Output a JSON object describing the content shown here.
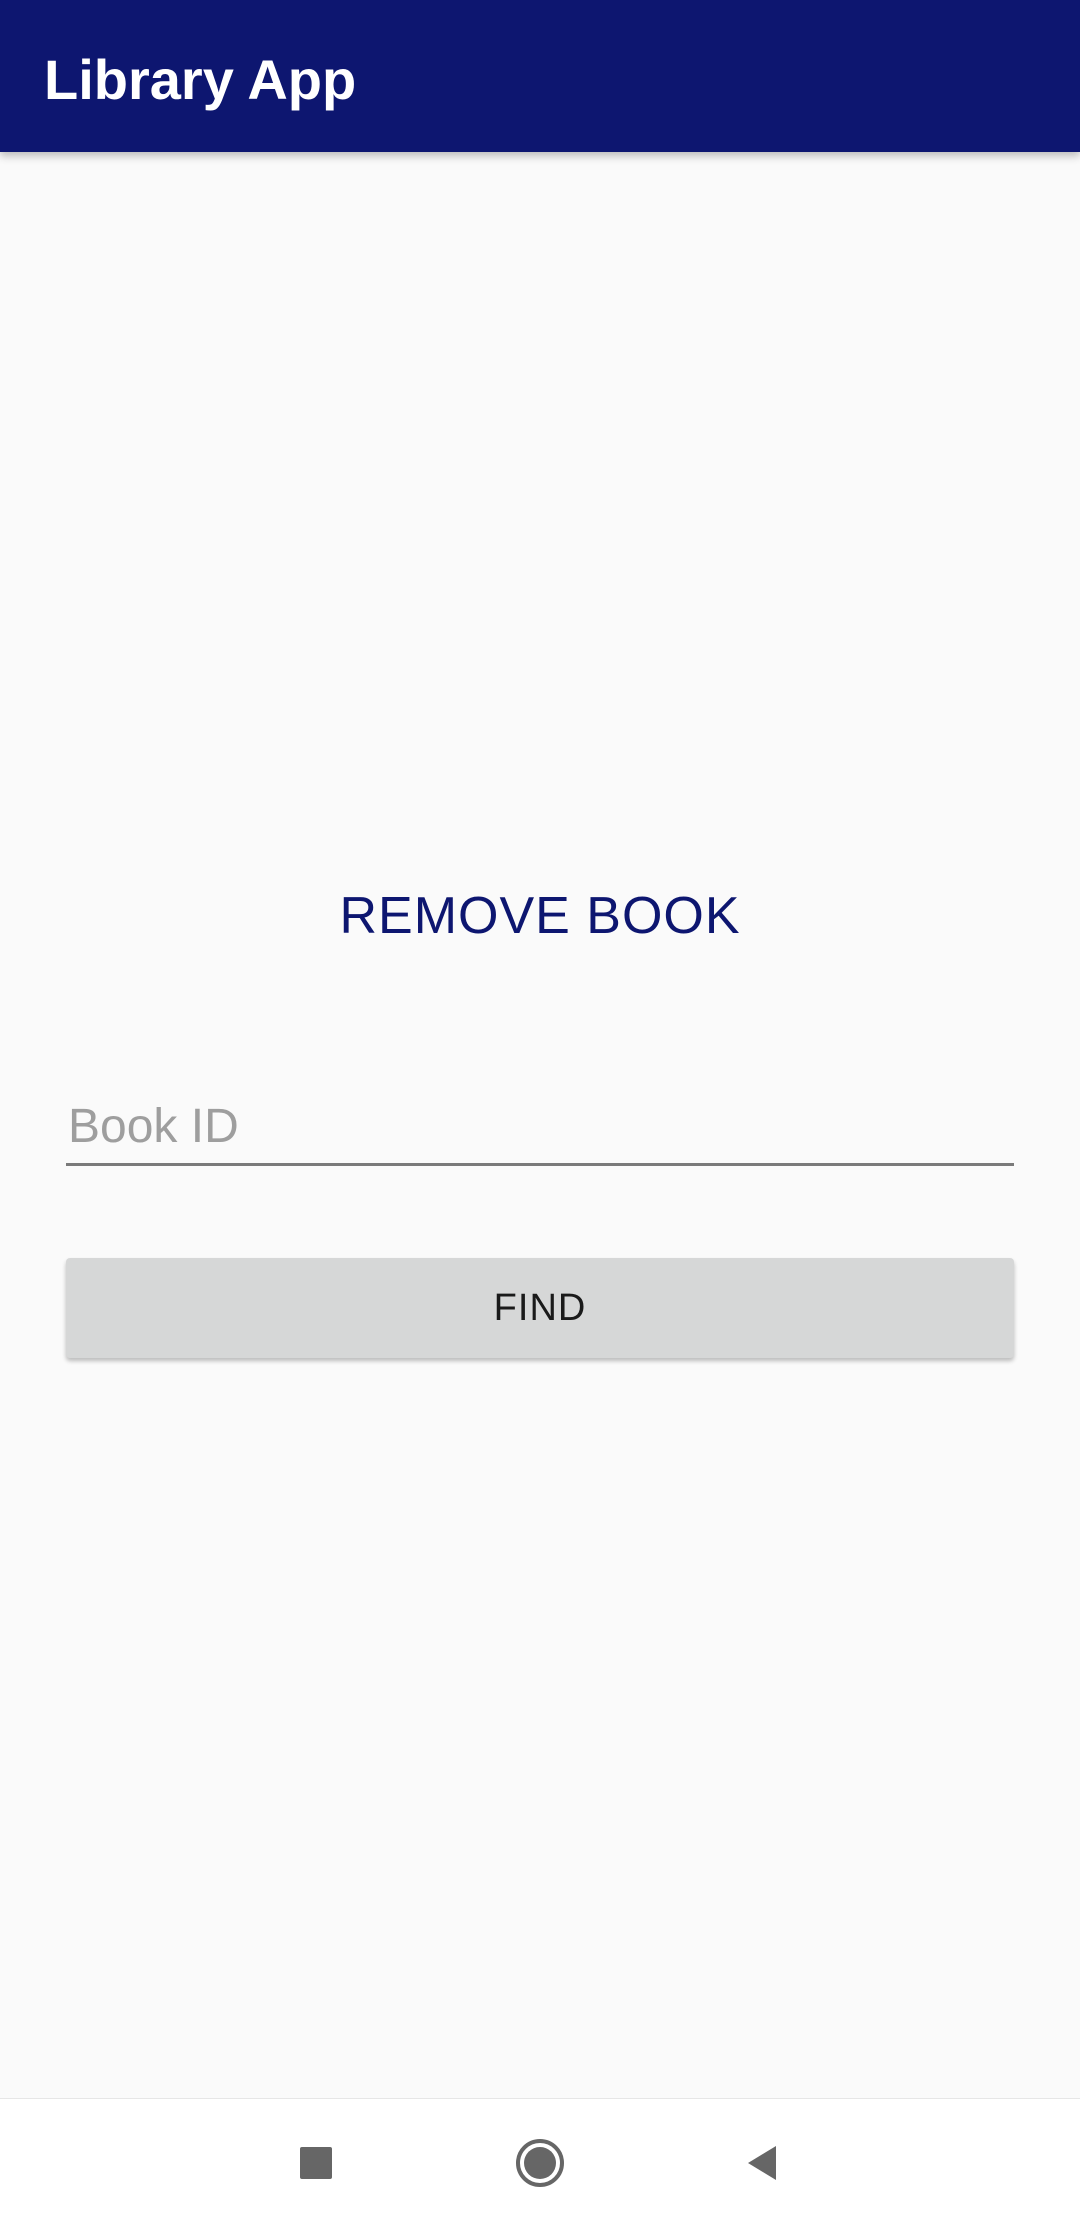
{
  "app_bar": {
    "title": "Library App",
    "background_color": "#0d1670"
  },
  "main": {
    "heading": "REMOVE BOOK",
    "book_id_field": {
      "placeholder": "Book ID",
      "value": ""
    },
    "find_button_label": "FIND"
  },
  "nav_bar": {
    "icons": [
      "recents-square-icon",
      "home-circle-icon",
      "back-triangle-icon"
    ]
  }
}
